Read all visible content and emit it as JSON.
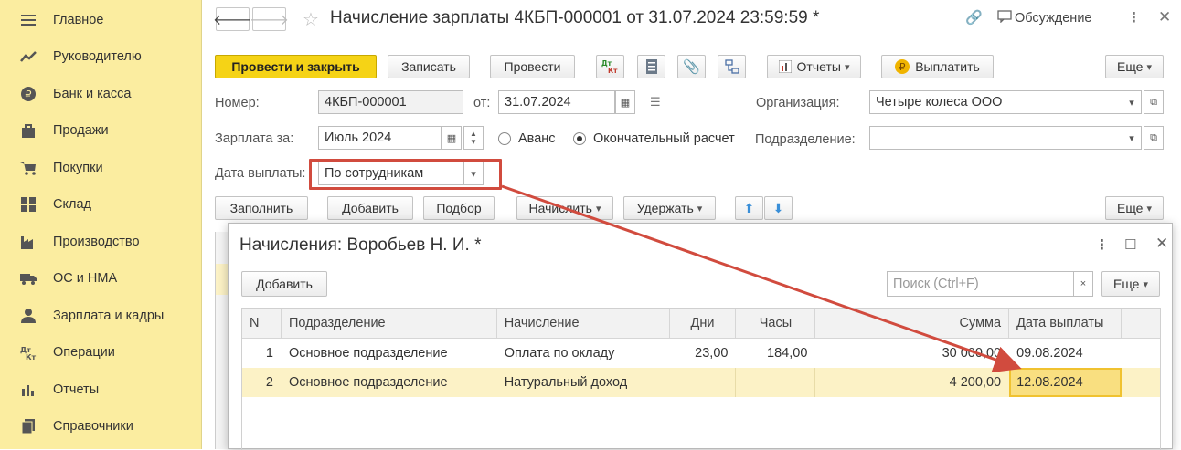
{
  "sidebar": {
    "items": [
      {
        "label": "Главное",
        "icon": "menu-icon"
      },
      {
        "label": "Руководителю",
        "icon": "trend-icon"
      },
      {
        "label": "Банк и касса",
        "icon": "ruble-coin-icon"
      },
      {
        "label": "Продажи",
        "icon": "shopping-bag-icon"
      },
      {
        "label": "Покупки",
        "icon": "cart-icon"
      },
      {
        "label": "Склад",
        "icon": "warehouse-icon"
      },
      {
        "label": "Производство",
        "icon": "factory-icon"
      },
      {
        "label": "ОС и НМА",
        "icon": "truck-icon"
      },
      {
        "label": "Зарплата и кадры",
        "icon": "person-icon"
      },
      {
        "label": "Операции",
        "icon": "debit-credit-icon"
      },
      {
        "label": "Отчеты",
        "icon": "bar-chart-icon"
      },
      {
        "label": "Справочники",
        "icon": "books-icon"
      }
    ]
  },
  "header": {
    "title": "Начисление зарплаты 4КБП-000001 от 31.07.2024 23:59:59 *",
    "discussion": "Обсуждение"
  },
  "toolbar": {
    "post_close": "Провести и закрыть",
    "save": "Записать",
    "post": "Провести",
    "dt_kt": "Дт\nКт",
    "reports": "Отчеты",
    "pay": "Выплатить",
    "more": "Еще"
  },
  "form": {
    "number_label": "Номер:",
    "number_value": "4КБП-000001",
    "date_label": "от:",
    "date_value": "31.07.2024",
    "org_label": "Организация:",
    "org_value": "Четыре колеса ООО",
    "salary_for_label": "Зарплата за:",
    "salary_for_value": "Июль 2024",
    "advance_label": "Аванс",
    "final_label": "Окончательный расчет",
    "dept_label": "Подразделение:",
    "dept_value": "",
    "pay_date_label": "Дата выплаты:",
    "pay_date_value": "По сотрудникам"
  },
  "table_toolbar": {
    "fill": "Заполнить",
    "add": "Добавить",
    "select": "Подбор",
    "accrue": "Начислить",
    "withhold": "Удержать",
    "more": "Еще"
  },
  "popup": {
    "title": "Начисления: Воробьев Н. И. *",
    "add": "Добавить",
    "search_placeholder": "Поиск (Ctrl+F)",
    "more": "Еще",
    "columns": [
      "N",
      "Подразделение",
      "Начисление",
      "Дни",
      "Часы",
      "Сумма",
      "Дата выплаты"
    ],
    "rows": [
      {
        "n": "1",
        "dept": "Основное подразделение",
        "accrual": "Оплата по окладу",
        "days": "23,00",
        "hours": "184,00",
        "sum": "30 000,00",
        "date": "09.08.2024"
      },
      {
        "n": "2",
        "dept": "Основное подразделение",
        "accrual": "Натуральный доход",
        "days": "",
        "hours": "",
        "sum": "4 200,00",
        "date": "12.08.2024"
      }
    ]
  },
  "colors": {
    "sidebar_bg": "#fbeda0",
    "primary_button": "#f5d316",
    "annotation": "#d14b3e",
    "selected_row": "#fcf2c6"
  }
}
